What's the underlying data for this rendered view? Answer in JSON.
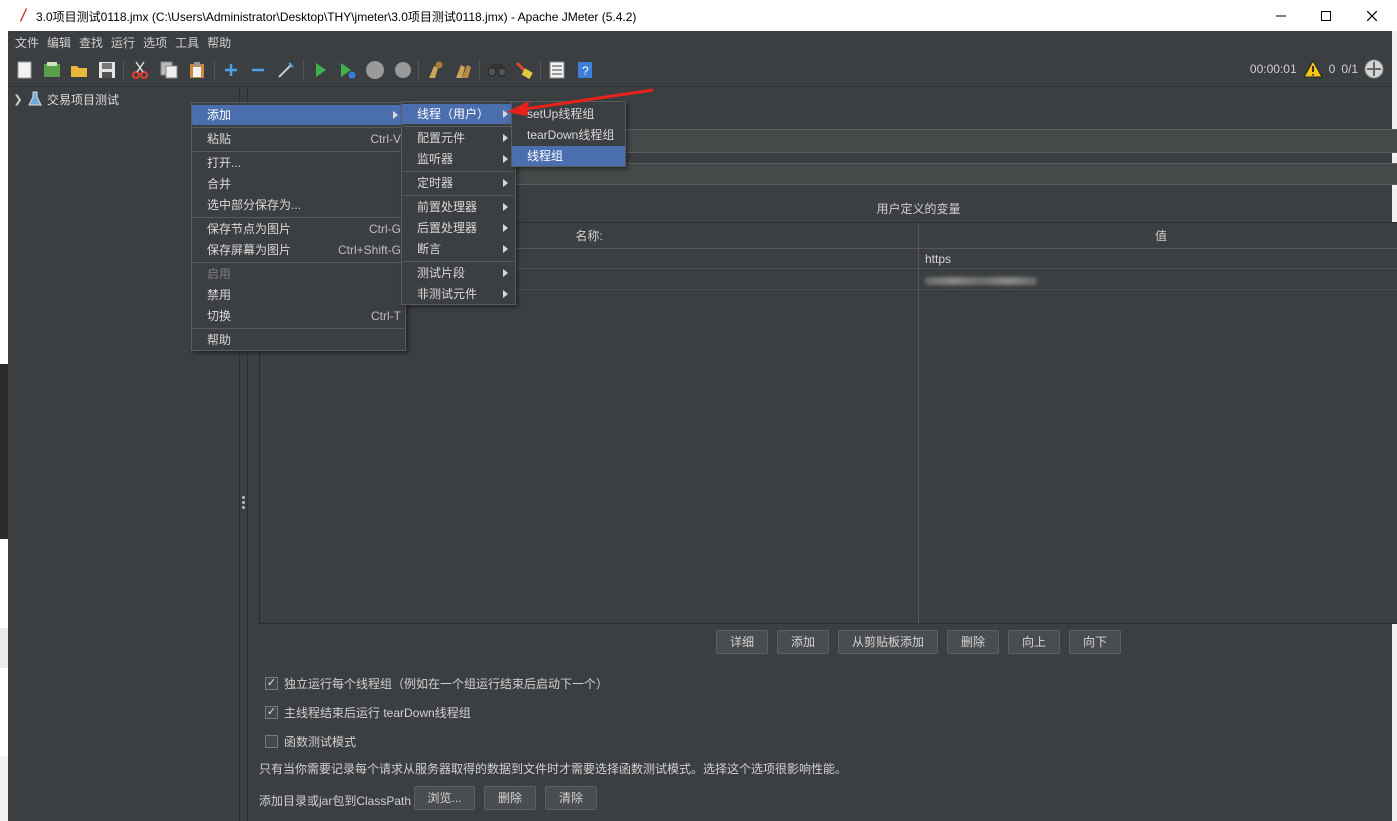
{
  "window": {
    "title": "3.0项目测试0118.jmx (C:\\Users\\Administrator\\Desktop\\THY\\jmeter\\3.0项目测试0118.jmx) - Apache JMeter (5.4.2)"
  },
  "menubar": {
    "items": [
      "文件",
      "编辑",
      "查找",
      "运行",
      "选项",
      "工具",
      "帮助"
    ]
  },
  "status": {
    "timer": "00:00:01",
    "warnings": "0",
    "threads": "0/1"
  },
  "tree": {
    "root_label": "交易项目测试"
  },
  "context_menu": {
    "add": "添加",
    "paste": "粘贴",
    "paste_shortcut": "Ctrl-V",
    "open": "打开...",
    "merge": "合并",
    "save_selection_as": "选中部分保存为...",
    "save_node_image": "保存节点为图片",
    "save_node_image_shortcut": "Ctrl-G",
    "save_screen_image": "保存屏幕为图片",
    "save_screen_image_shortcut": "Ctrl+Shift-G",
    "enable": "启用",
    "disable": "禁用",
    "toggle": "切换",
    "toggle_shortcut": "Ctrl-T",
    "help": "帮助"
  },
  "add_submenu": {
    "threads": "线程（用户）",
    "config_element": "配置元件",
    "listener": "监听器",
    "timer": "定时器",
    "pre_processor": "前置处理器",
    "post_processor": "后置处理器",
    "assertion": "断言",
    "test_fragment": "测试片段",
    "non_test_element": "非测试元件"
  },
  "threads_submenu": {
    "setup": "setUp线程组",
    "teardown": "tearDown线程组",
    "thread_group": "线程组"
  },
  "variables": {
    "caption": "用户定义的变量",
    "col_name": "名称:",
    "col_value": "值",
    "row1_value": "https"
  },
  "buttons": {
    "detail": "详细",
    "add": "添加",
    "add_from_clipboard": "从剪贴板添加",
    "delete": "删除",
    "up": "向上",
    "down": "向下"
  },
  "options": {
    "run_groups_consecutively": "独立运行每个线程组（例如在一个组运行结束后启动下一个）",
    "run_teardown": "主线程结束后运行 tearDown线程组",
    "functional_mode": "函数测试模式",
    "functional_note": "只有当你需要记录每个请求从服务器取得的数据到文件时才需要选择函数测试模式。选择这个选项很影响性能。"
  },
  "classpath": {
    "label": "添加目录或jar包到ClassPath",
    "browse": "浏览...",
    "delete": "删除",
    "clear": "清除"
  }
}
